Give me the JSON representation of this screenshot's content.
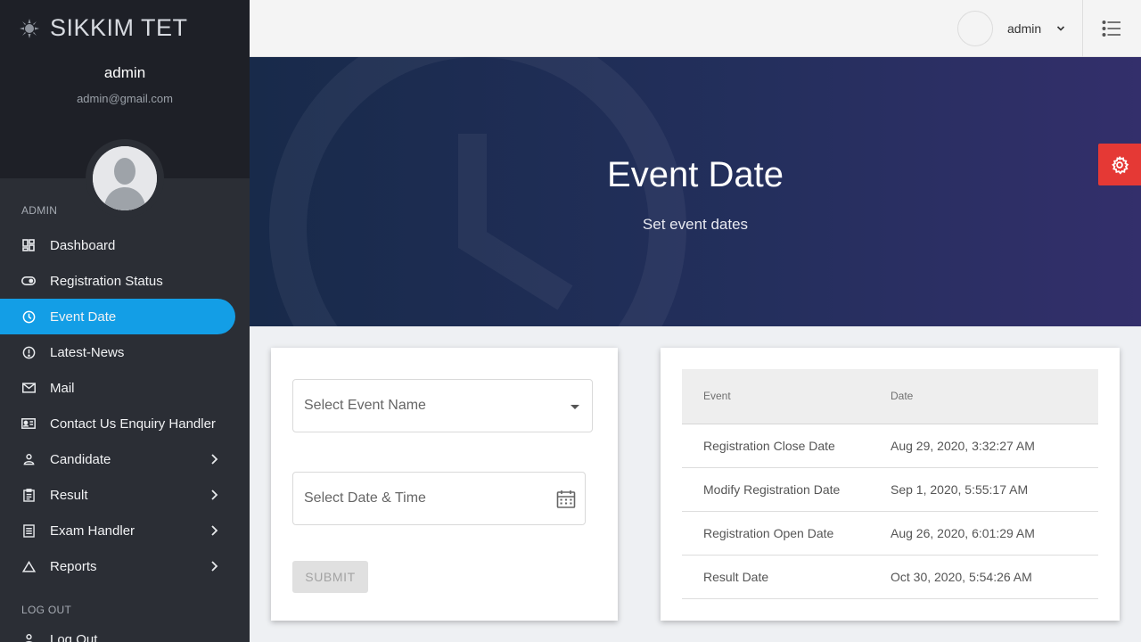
{
  "brand": {
    "title": "SIKKIM TET",
    "logo_icon": "emblem-icon"
  },
  "user": {
    "name": "admin",
    "email": "admin@gmail.com"
  },
  "sidebar": {
    "section_admin": "ADMIN",
    "section_logout": "LOG OUT",
    "items": [
      {
        "label": "Dashboard",
        "icon": "dashboard-icon",
        "active": false,
        "has_submenu": false
      },
      {
        "label": "Registration Status",
        "icon": "toggle-icon",
        "active": false,
        "has_submenu": false
      },
      {
        "label": "Event Date",
        "icon": "clock-icon",
        "active": true,
        "has_submenu": false
      },
      {
        "label": "Latest-News",
        "icon": "alert-clock-icon",
        "active": false,
        "has_submenu": false
      },
      {
        "label": "Mail",
        "icon": "mail-icon",
        "active": false,
        "has_submenu": false
      },
      {
        "label": "Contact Us Enquiry Handler",
        "icon": "contact-card-icon",
        "active": false,
        "has_submenu": false
      },
      {
        "label": "Candidate",
        "icon": "person-icon",
        "active": false,
        "has_submenu": true
      },
      {
        "label": "Result",
        "icon": "clipboard-icon",
        "active": false,
        "has_submenu": true
      },
      {
        "label": "Exam Handler",
        "icon": "list-doc-icon",
        "active": false,
        "has_submenu": true
      },
      {
        "label": "Reports",
        "icon": "triangle-icon",
        "active": false,
        "has_submenu": true
      }
    ],
    "logout_label": "Log Out"
  },
  "topbar": {
    "user_label": "admin",
    "menu_icon": "list-icon"
  },
  "hero": {
    "title": "Event Date",
    "subtitle": "Set event dates"
  },
  "form": {
    "event_select_placeholder": "Select Event Name",
    "date_placeholder": "Select Date & Time",
    "submit_label": "SUBMIT"
  },
  "table": {
    "headers": [
      "Event",
      "Date"
    ],
    "rows": [
      [
        "Registration Close Date",
        "Aug 29, 2020, 3:32:27 AM"
      ],
      [
        "Modify Registration Date",
        "Sep 1, 2020, 5:55:17 AM"
      ],
      [
        "Registration Open Date",
        "Aug 26, 2020, 6:01:29 AM"
      ],
      [
        "Result Date",
        "Oct 30, 2020, 5:54:26 AM"
      ]
    ]
  },
  "colors": {
    "sidebar_bg": "#2b2e35",
    "sidebar_head": "#1e2027",
    "active_item": "#139ee6",
    "hero_start": "#182a4a",
    "hero_end": "#332f6b",
    "settings_tab": "#e53935"
  }
}
